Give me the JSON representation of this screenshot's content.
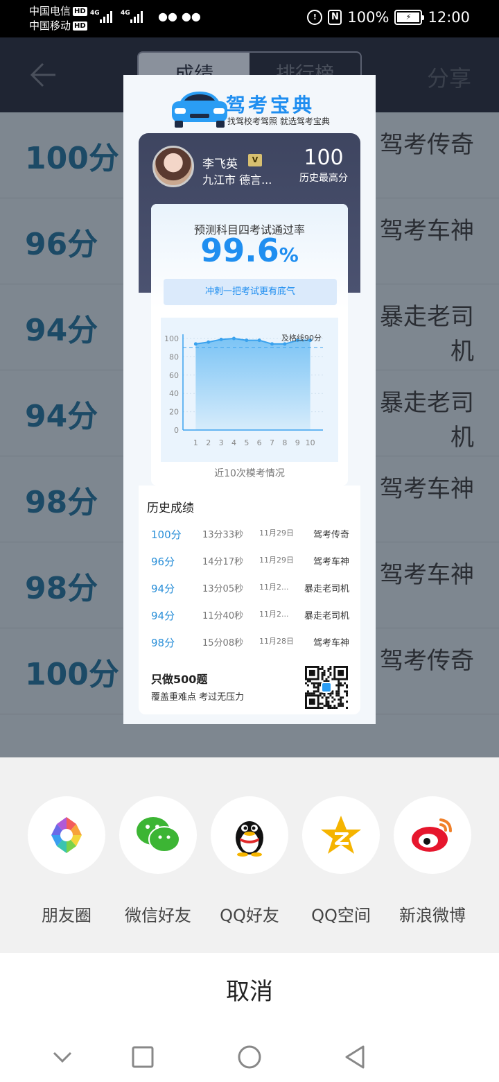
{
  "status_bar": {
    "carrier1": "中国电信",
    "carrier2": "中国移动",
    "hd": "HD",
    "net1": "4G",
    "net2": "4G",
    "battery_pct": "100%",
    "time": "12:00"
  },
  "header": {
    "tabs": [
      {
        "label": "成绩",
        "active": true
      },
      {
        "label": "排行榜",
        "active": false
      }
    ],
    "share_label": "分享"
  },
  "bg_rows": [
    {
      "score": "100分",
      "title": "驾考传奇"
    },
    {
      "score": "96分",
      "title": "驾考车神"
    },
    {
      "score": "94分",
      "title": "暴走老司机"
    },
    {
      "score": "94分",
      "title": "暴走老司机"
    },
    {
      "score": "98分",
      "title": "驾考车神"
    },
    {
      "score": "98分",
      "title": "驾考车神"
    },
    {
      "score": "100分",
      "title": "驾考传奇"
    }
  ],
  "card": {
    "brand": "驾考宝典",
    "tagline": "找驾校考驾照 就选驾考宝典",
    "user": {
      "name": "李飞英",
      "vip": "V",
      "location": "九江市  德言..."
    },
    "best_score": "100",
    "best_label": "历史最高分",
    "pass_label": "预测科目四考试通过率",
    "pass_rate": "99.6",
    "pass_unit": "%",
    "slogan": "冲刺一把考试更有底气",
    "chart_caption": "近10次模考情况",
    "history_title": "历史成绩",
    "history": [
      {
        "score": "100分",
        "time": "13分33秒",
        "date": "11月29日",
        "title": "驾考传奇"
      },
      {
        "score": "96分",
        "time": "14分17秒",
        "date": "11月29日",
        "title": "驾考车神"
      },
      {
        "score": "94分",
        "time": "13分05秒",
        "date": "11月2...",
        "title": "暴走老司机"
      },
      {
        "score": "94分",
        "time": "11分40秒",
        "date": "11月2...",
        "title": "暴走老司机"
      },
      {
        "score": "98分",
        "time": "15分08秒",
        "date": "11月28日",
        "title": "驾考车神"
      }
    ],
    "promo_title": "只做500题",
    "promo_sub": "覆盖重难点 考过无压力"
  },
  "chart_data": {
    "type": "area",
    "x": [
      1,
      2,
      3,
      4,
      5,
      6,
      7,
      8,
      9,
      10
    ],
    "values": [
      94,
      96,
      99,
      100,
      98,
      98,
      94,
      94,
      98,
      98
    ],
    "ylim": [
      0,
      100
    ],
    "yticks": [
      0,
      20,
      40,
      60,
      80,
      100
    ],
    "pass_line": 90,
    "pass_line_label": "及格线90分"
  },
  "share_targets": [
    {
      "label": "朋友圈",
      "icon": "moments-icon"
    },
    {
      "label": "微信好友",
      "icon": "wechat-icon"
    },
    {
      "label": "QQ好友",
      "icon": "qq-icon"
    },
    {
      "label": "QQ空间",
      "icon": "qzone-icon"
    },
    {
      "label": "新浪微博",
      "icon": "weibo-icon"
    }
  ],
  "cancel_label": "取消",
  "colors": {
    "accent": "#1f8ef0",
    "card_header": "#3e4560",
    "overlay": "#808a94"
  }
}
